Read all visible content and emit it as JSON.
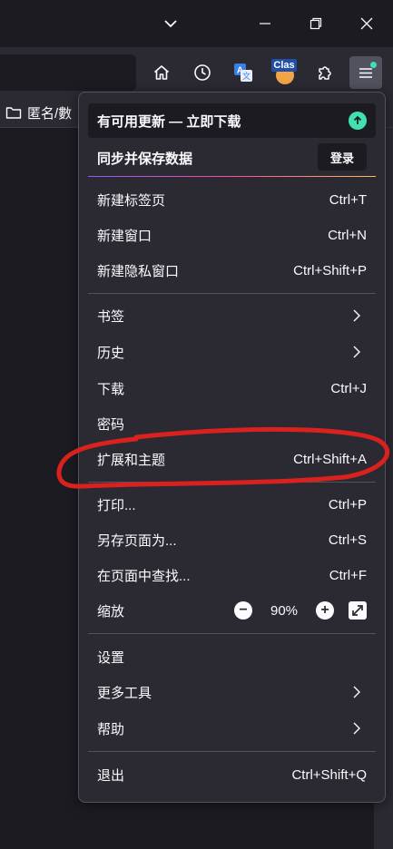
{
  "bookmarks": {
    "folder_label": "匿名/數"
  },
  "nav": {
    "ext_label": "Clas"
  },
  "menu": {
    "update_banner": "有可用更新 — 立即下载",
    "sync_label": "同步并保存数据",
    "login_button": "登录",
    "new_tab": {
      "label": "新建标签页",
      "shortcut": "Ctrl+T"
    },
    "new_window": {
      "label": "新建窗口",
      "shortcut": "Ctrl+N"
    },
    "new_private": {
      "label": "新建隐私窗口",
      "shortcut": "Ctrl+Shift+P"
    },
    "bookmarks": {
      "label": "书签"
    },
    "history": {
      "label": "历史"
    },
    "downloads": {
      "label": "下载",
      "shortcut": "Ctrl+J"
    },
    "passwords": {
      "label": "密码"
    },
    "addons": {
      "label": "扩展和主题",
      "shortcut": "Ctrl+Shift+A"
    },
    "print": {
      "label": "打印...",
      "shortcut": "Ctrl+P"
    },
    "save_page": {
      "label": "另存页面为...",
      "shortcut": "Ctrl+S"
    },
    "find": {
      "label": "在页面中查找...",
      "shortcut": "Ctrl+F"
    },
    "zoom": {
      "label": "缩放",
      "value": "90%",
      "minus": "−",
      "plus": "+"
    },
    "settings": {
      "label": "设置"
    },
    "more_tools": {
      "label": "更多工具"
    },
    "help": {
      "label": "帮助"
    },
    "quit": {
      "label": "退出",
      "shortcut": "Ctrl+Shift+Q"
    }
  },
  "colors": {
    "menu_bg": "#2b2a33",
    "update_dot": "#3fe1b0",
    "annotation": "#d9211e"
  }
}
